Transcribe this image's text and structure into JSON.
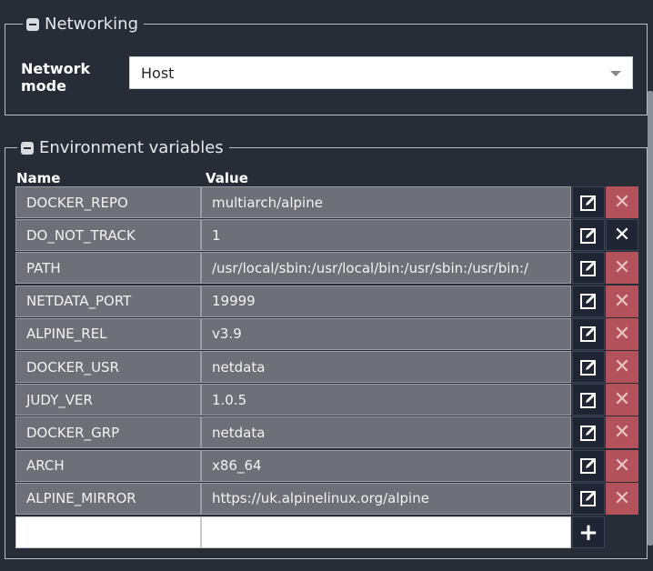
{
  "networking": {
    "legend": "Networking",
    "network_mode_label": "Network mode",
    "network_mode_value": "Host"
  },
  "env": {
    "legend": "Environment variables",
    "col_name": "Name",
    "col_value": "Value",
    "rows": [
      {
        "name": "DOCKER_REPO",
        "value": "multiarch/alpine"
      },
      {
        "name": "DO_NOT_TRACK",
        "value": "1"
      },
      {
        "name": "PATH",
        "value": "/usr/local/sbin:/usr/local/bin:/usr/sbin:/usr/bin:/"
      },
      {
        "name": "NETDATA_PORT",
        "value": "19999"
      },
      {
        "name": "ALPINE_REL",
        "value": "v3.9"
      },
      {
        "name": "DOCKER_USR",
        "value": "netdata"
      },
      {
        "name": "JUDY_VER",
        "value": "1.0.5"
      },
      {
        "name": "DOCKER_GRP",
        "value": "netdata"
      },
      {
        "name": "ARCH",
        "value": "x86_64"
      },
      {
        "name": "ALPINE_MIRROR",
        "value": "https://uk.alpinelinux.org/alpine"
      }
    ],
    "new_row": {
      "name_value": "",
      "value_value": ""
    }
  },
  "icons": {
    "collapse": "minus-icon",
    "edit": "edit-icon",
    "delete": "close-icon",
    "add": "plus-icon",
    "dropdown": "chevron-down-icon"
  },
  "colors": {
    "background": "#262d37",
    "cell": "#6f6f78",
    "delete": "#b4525c",
    "button": "#1f2533"
  }
}
